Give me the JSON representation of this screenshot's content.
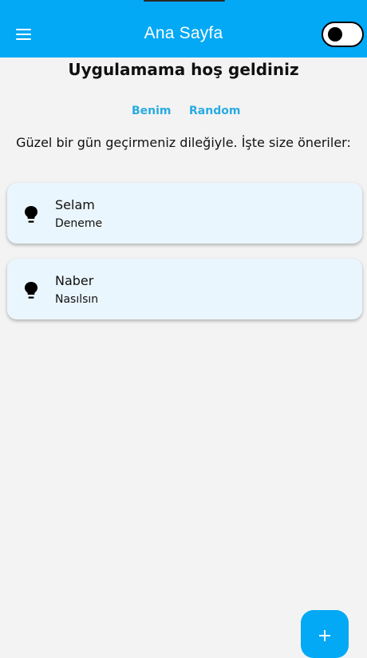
{
  "app_bar": {
    "title": "Ana Sayfa",
    "menu_icon": "menu-icon",
    "theme_toggle": {
      "state": "off"
    }
  },
  "welcome_text": "Uygulamama hoş geldiniz",
  "tabs": [
    {
      "label": "Benim"
    },
    {
      "label": "Random"
    }
  ],
  "subtitle": "Güzel bir gün geçirmeniz dileğiyle. İşte size öneriler:",
  "cards": [
    {
      "icon": "lightbulb-icon",
      "title": "Selam",
      "subtitle": "Deneme"
    },
    {
      "icon": "lightbulb-icon",
      "title": "Naber",
      "subtitle": "Nasılsın"
    }
  ],
  "fab": {
    "icon": "plus-icon"
  },
  "colors": {
    "primary": "#03a9f4",
    "background": "#f3f3f3",
    "card": "#eaf6fd",
    "tab_text": "#29abe2"
  }
}
